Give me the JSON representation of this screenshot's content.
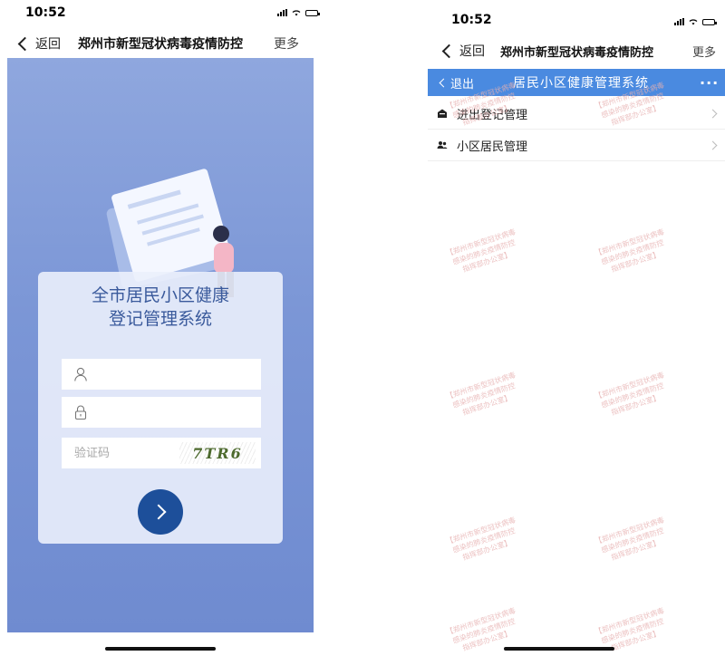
{
  "left_screen": {
    "status": {
      "time": "10:52"
    },
    "nav": {
      "back_label": "返回",
      "title": "郑州市新型冠状病毒疫情防控",
      "more_label": "更多"
    },
    "login": {
      "title_line1": "全市居民小区健康",
      "title_line2": "登记管理系统",
      "username_placeholder": "",
      "password_placeholder": "",
      "captcha_placeholder": "验证码",
      "captcha_text": "7TR6",
      "submit_icon": "chevron-right-icon"
    }
  },
  "right_screen": {
    "status": {
      "time": "10:52"
    },
    "nav": {
      "back_label": "返回",
      "title": "郑州市新型冠状病毒疫情防控",
      "more_label": "更多"
    },
    "header": {
      "exit_label": "退出",
      "title": "居民小区健康管理系统",
      "more_label": "···"
    },
    "menu": [
      {
        "label": "进出登记管理",
        "icon": "building-icon"
      },
      {
        "label": "小区居民管理",
        "icon": "people-icon"
      }
    ],
    "watermark": "【郑州市新型冠状病毒\n感染的肺炎疫情防控\n指挥部办公室】"
  },
  "colors": {
    "header_blue": "#4a8ae0",
    "login_bg": "#7b96d6",
    "submit_blue": "#1d4f9a",
    "title_blue": "#3a5a9c"
  }
}
